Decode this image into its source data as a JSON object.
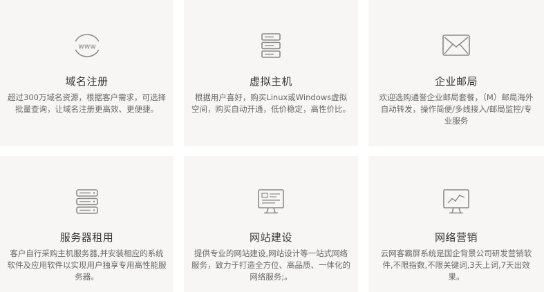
{
  "services": [
    {
      "title": "域名注册",
      "icon": "www-globe-icon",
      "description": "超过300万域名资源，根据客户需求，可选择批量查询，让域名注册更高效、更便捷。"
    },
    {
      "title": "虚拟主机",
      "icon": "server-stack-icon",
      "description": "根据用户喜好，购买Linux或Windows虚拟空间，购买自动开通，低价稳定，高性价比。"
    },
    {
      "title": "企业邮局",
      "icon": "envelope-icon",
      "description": "欢迎选购通誉企业邮局套餐，（M）邮局海外自动转发，操作简便/多线接入/邮局监控/专业服务"
    },
    {
      "title": "服务器租用",
      "icon": "server-rack-icon",
      "description": "客户自行采购主机服务器,并安装相应的系统软件及应用软件以实现用户独享专用高性能服务器。"
    },
    {
      "title": "网站建设",
      "icon": "website-monitor-icon",
      "description": "提供专业的网站建设,网站设计等一站式网络服务，致力于打造全方位、高品质、一体化的网络服务;。"
    },
    {
      "title": "网络营销",
      "icon": "chart-monitor-icon",
      "description": "云网客霸屏系统是国企背景公司研发营销软件,不限指数,不限关键词,3天上词,7天出效果。"
    }
  ],
  "colors": {
    "card_bg": "#f7f6f5",
    "icon_stroke": "#8a8a8a",
    "title": "#333333",
    "desc": "#666666"
  }
}
